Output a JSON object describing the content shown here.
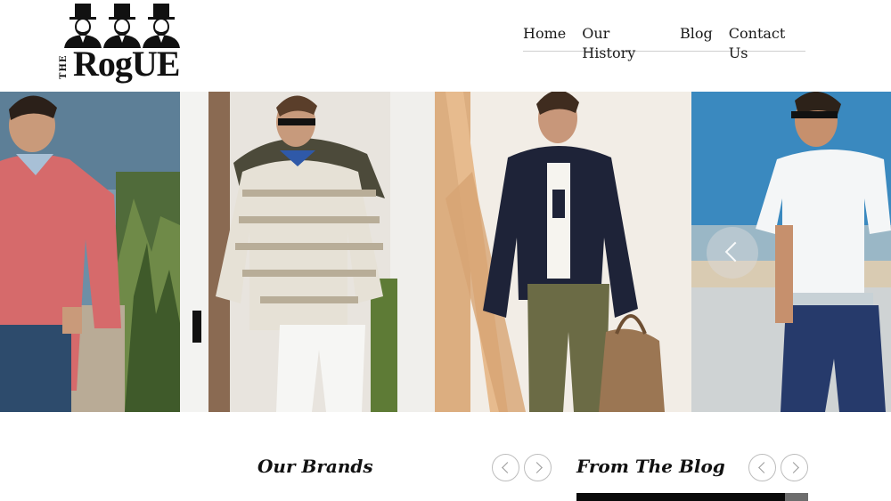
{
  "header": {
    "logo": {
      "alt": "The Rogue logo",
      "prefix": "THE",
      "name": "RogUE"
    },
    "nav": [
      {
        "label": "Home"
      },
      {
        "label": "Our History"
      },
      {
        "label": "Blog"
      },
      {
        "label": "Contact Us"
      }
    ]
  },
  "hero": {
    "slides": [
      {
        "name": "pink-quarter-zip-model"
      },
      {
        "name": "striped-sweater-model"
      },
      {
        "name": "navy-jacket-model"
      },
      {
        "name": "white-polo-model"
      }
    ],
    "arrow_icon": "chevron-left-icon"
  },
  "sections": {
    "brands": {
      "title": "Our Brands"
    },
    "blog": {
      "title": "From The Blog"
    }
  },
  "colors": {
    "text": "#111111",
    "nav_rule": "#cfcfcf",
    "button_border": "#bdbdbd"
  }
}
